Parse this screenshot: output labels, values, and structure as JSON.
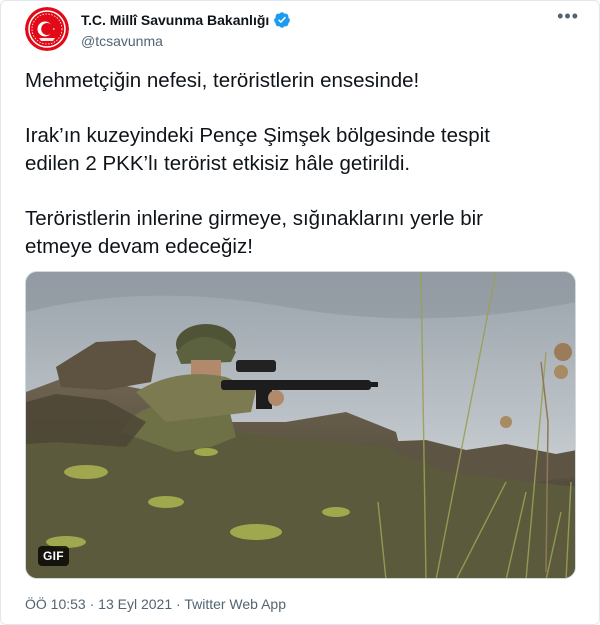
{
  "account": {
    "display_name": "T.C. Millî Savunma Bakanlığı",
    "handle": "@tcsavunma",
    "verified": true,
    "avatar_icon": "ministry-crest-icon",
    "brand_color": "#e30a17"
  },
  "more_icon": "more-options-icon",
  "tweet": {
    "paragraphs": [
      [
        "Mehmetçiğin nefesi, teröristlerin ensesinde!"
      ],
      [
        "Irak’ın kuzeyindeki Pençe Şimşek bölgesinde tespit",
        "edilen 2 PKK’lı terörist etkisiz hâle getirildi."
      ],
      [
        "Teröristlerin inlerine girmeye, sığınaklarını yerle bir",
        "etmeye devam edeceğiz!"
      ]
    ]
  },
  "media": {
    "badge": "GIF"
  },
  "meta": {
    "time": "ÖÖ 10:53",
    "separator": " · ",
    "date": "13 Eyl 2021",
    "source": "Twitter Web App"
  },
  "colors": {
    "text": "#0f1419",
    "secondary": "#536471",
    "verified": "#1d9bf0"
  }
}
